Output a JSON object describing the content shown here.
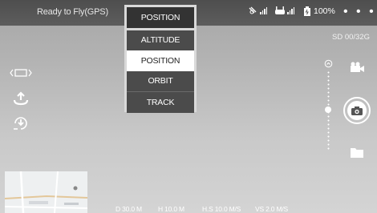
{
  "status": {
    "text": "Ready to Fly(GPS)"
  },
  "mode_dropdown": {
    "current": "POSITION",
    "options": [
      "ALTITUDE",
      "POSITION",
      "ORBIT",
      "TRACK"
    ],
    "selected": "POSITION"
  },
  "indicators": {
    "battery": "100%",
    "more_menu": "• • •"
  },
  "storage": {
    "text": "SD 00/32G"
  },
  "telemetry": {
    "distance": "D 30.0 M",
    "height": "H 10.0 M",
    "hspeed": "H.S 10.0 M/S",
    "vspeed": "VS  2.0 M/S"
  },
  "icons": [
    "gps-signal-icon",
    "remote-signal-icon",
    "battery-icon",
    "more-icon",
    "expand-icon",
    "takeoff-icon",
    "return-home-icon",
    "video-camera-icon",
    "zoom-icon",
    "camera-icon",
    "folder-icon"
  ]
}
